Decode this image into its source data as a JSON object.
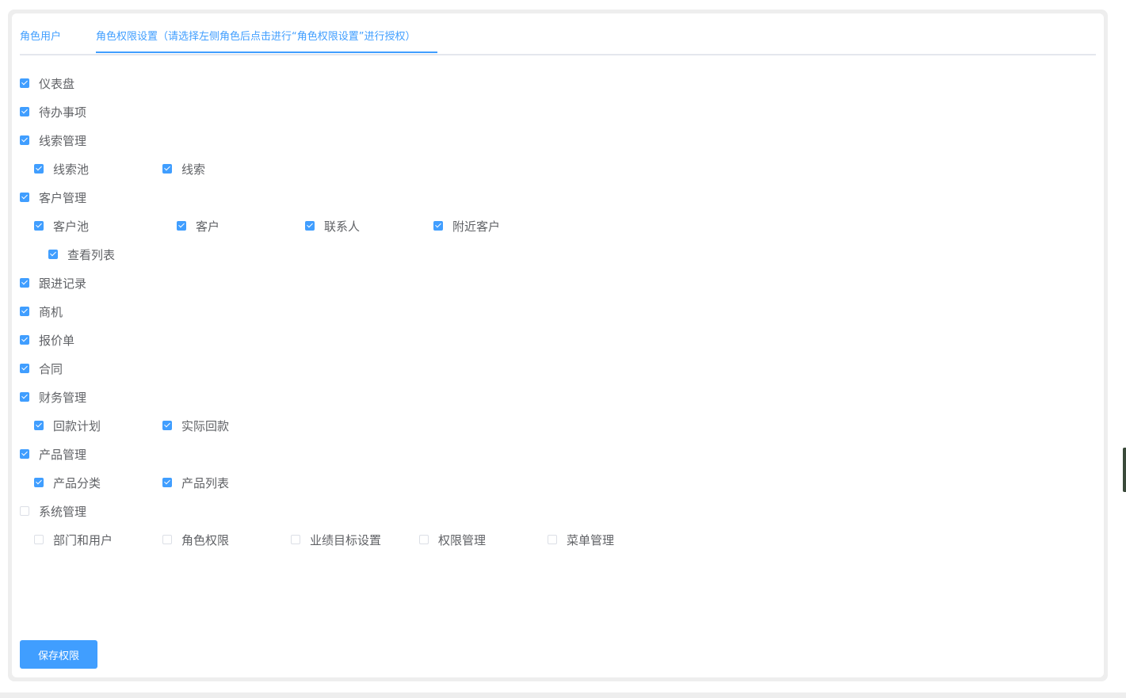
{
  "tabs": [
    {
      "label": "角色用户"
    },
    {
      "label": "角色权限设置（请选择左侧角色后点击进行“角色权限设置”进行授权）"
    }
  ],
  "perms": {
    "dashboard": {
      "label": "仪表盘",
      "checked": true
    },
    "todo": {
      "label": "待办事项",
      "checked": true
    },
    "lead_mgmt": {
      "label": "线索管理",
      "checked": true
    },
    "lead_pool": {
      "label": "线索池",
      "checked": true
    },
    "lead": {
      "label": "线索",
      "checked": true
    },
    "customer_mgmt": {
      "label": "客户管理",
      "checked": true
    },
    "customer_pool": {
      "label": "客户池",
      "checked": true
    },
    "customer": {
      "label": "客户",
      "checked": true
    },
    "contact": {
      "label": "联系人",
      "checked": true
    },
    "nearby_customer": {
      "label": "附近客户",
      "checked": true
    },
    "view_list": {
      "label": "查看列表",
      "checked": true
    },
    "followup": {
      "label": "跟进记录",
      "checked": true
    },
    "opportunity": {
      "label": "商机",
      "checked": true
    },
    "quotation": {
      "label": "报价单",
      "checked": true
    },
    "contract": {
      "label": "合同",
      "checked": true
    },
    "finance_mgmt": {
      "label": "财务管理",
      "checked": true
    },
    "payment_plan": {
      "label": "回款计划",
      "checked": true
    },
    "actual_payment": {
      "label": "实际回款",
      "checked": true
    },
    "product_mgmt": {
      "label": "产品管理",
      "checked": true
    },
    "product_category": {
      "label": "产品分类",
      "checked": true
    },
    "product_list": {
      "label": "产品列表",
      "checked": true
    },
    "system_mgmt": {
      "label": "系统管理",
      "checked": false
    },
    "dept_users": {
      "label": "部门和用户",
      "checked": false
    },
    "role_perm": {
      "label": "角色权限",
      "checked": false
    },
    "perf_target": {
      "label": "业绩目标设置",
      "checked": false
    },
    "perm_mgmt": {
      "label": "权限管理",
      "checked": false
    },
    "menu_mgmt": {
      "label": "菜单管理",
      "checked": false
    }
  },
  "save_button": {
    "label": "保存权限"
  },
  "colors": {
    "accent": "#409eff",
    "text": "#606266",
    "checkbox_border": "#dcdfe6"
  }
}
